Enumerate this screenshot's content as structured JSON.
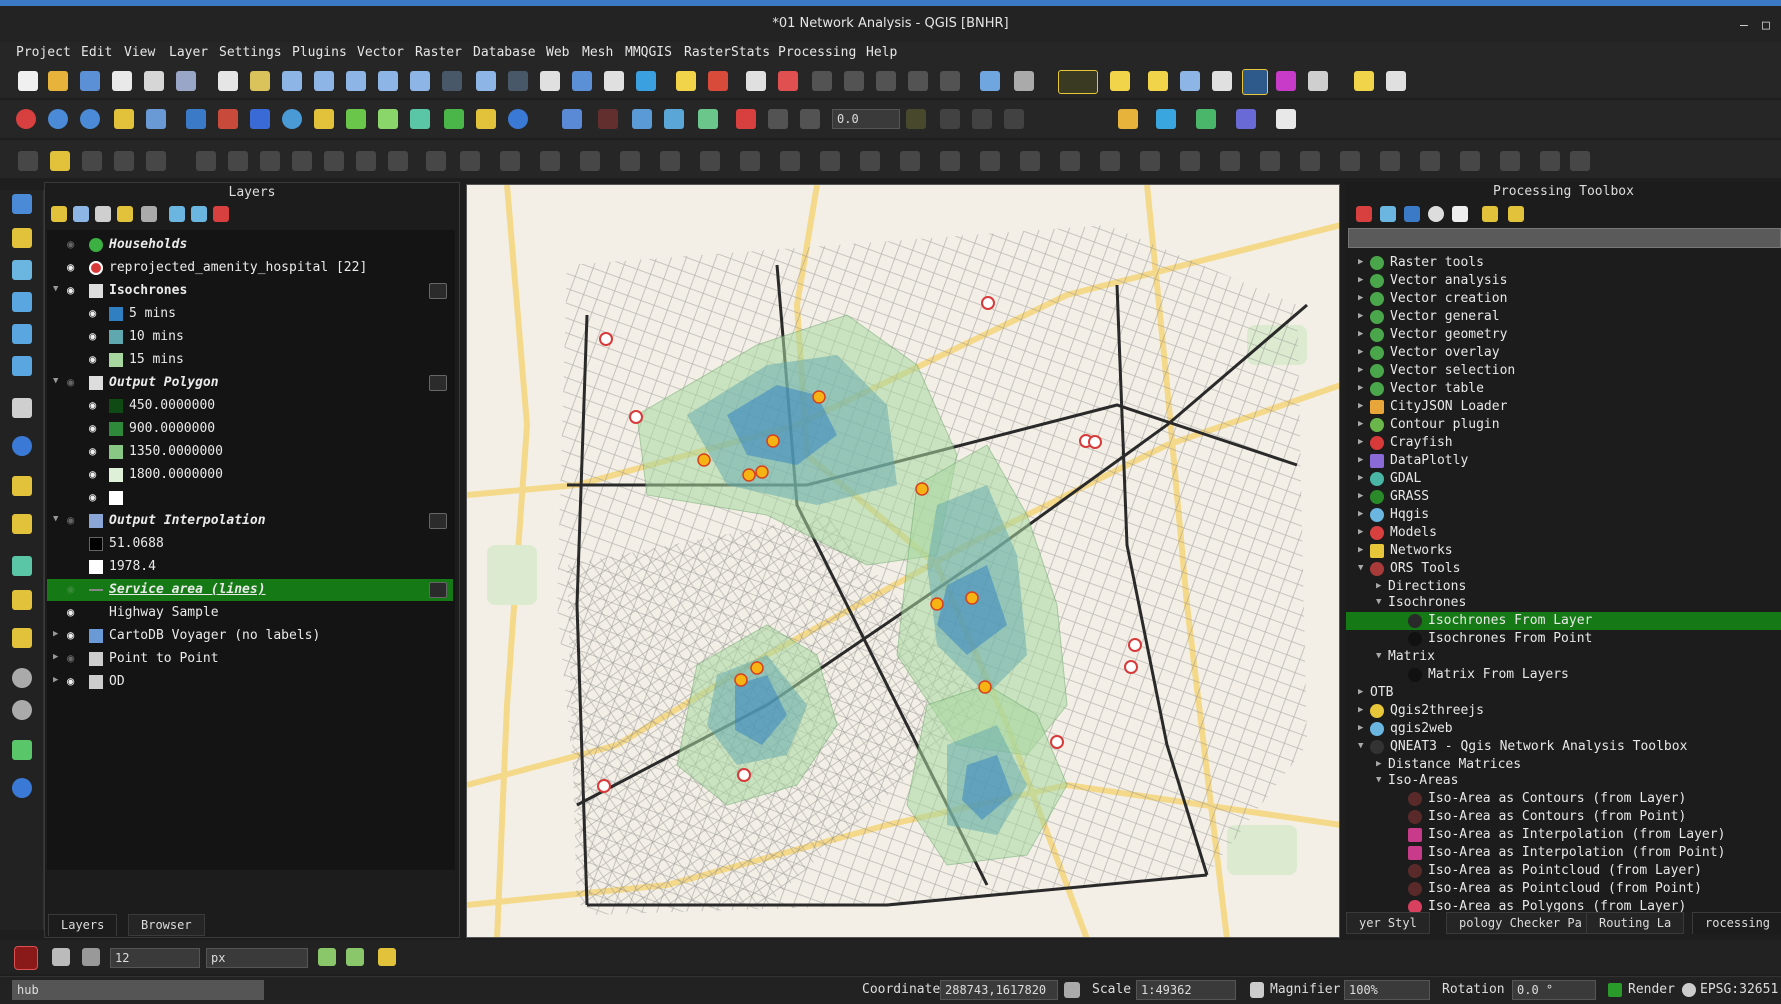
{
  "window": {
    "title": "*01 Network Analysis - QGIS [BNHR]",
    "minimize": "–",
    "maximize": "□"
  },
  "menu": [
    "Project",
    "Edit",
    "View",
    "Layer",
    "Settings",
    "Plugins",
    "Vector",
    "Raster",
    "Database",
    "Web",
    "Mesh",
    "MMQGIS",
    "RasterStats",
    "Processing",
    "Help"
  ],
  "toolbar2": {
    "opacity_value": "0.0"
  },
  "layers_panel": {
    "title": "Layers",
    "items": [
      {
        "label": "Households",
        "style": "bold italic",
        "symbol": "green-dot"
      },
      {
        "label": "reprojected_amenity_hospital [22]",
        "style": "",
        "symbol": "red-cross"
      },
      {
        "label": "Isochrones",
        "style": "bold",
        "symbol": "polygon-group"
      },
      {
        "label": "5 mins",
        "style": "",
        "symbol": "#2f7fc1"
      },
      {
        "label": "10 mins",
        "style": "",
        "symbol": "#5fa8b0"
      },
      {
        "label": "15 mins",
        "style": "",
        "symbol": "#a8d8a0"
      },
      {
        "label": "Output Polygon",
        "style": "bold italic",
        "symbol": "polygon-group"
      },
      {
        "label": "450.0000000",
        "style": "",
        "symbol": "#0f4a14"
      },
      {
        "label": "900.0000000",
        "style": "",
        "symbol": "#2e8a3a"
      },
      {
        "label": "1350.0000000",
        "style": "",
        "symbol": "#88c884"
      },
      {
        "label": "1800.0000000",
        "style": "",
        "symbol": "#dff0d8"
      },
      {
        "label": "",
        "style": "",
        "symbol": "#ffffff"
      },
      {
        "label": "Output Interpolation",
        "style": "bold italic",
        "symbol": "raster"
      },
      {
        "label": "51.0688",
        "style": "",
        "symbol": "#000000"
      },
      {
        "label": "1978.4",
        "style": "",
        "symbol": "#ffffff"
      },
      {
        "label": "Service area (lines)",
        "style": "bold italic underline",
        "symbol": "line"
      },
      {
        "label": "Highway Sample",
        "style": "",
        "symbol": "none"
      },
      {
        "label": "CartoDB Voyager (no labels)",
        "style": "",
        "symbol": "xyz"
      },
      {
        "label": "Point to Point",
        "style": "",
        "symbol": "group"
      },
      {
        "label": "OD",
        "style": "",
        "symbol": "group"
      }
    ],
    "tabs": [
      "Layers",
      "Browser"
    ]
  },
  "toolbox": {
    "title": "Processing Toolbox",
    "search_placeholder": "",
    "items": [
      "Raster tools",
      "Vector analysis",
      "Vector creation",
      "Vector general",
      "Vector geometry",
      "Vector overlay",
      "Vector selection",
      "Vector table",
      "CityJSON Loader",
      "Contour plugin",
      "Crayfish",
      "DataPlotly",
      "GDAL",
      "GRASS",
      "Hqgis",
      "Models",
      "Networks",
      "ORS Tools",
      "Directions",
      "Isochrones",
      "Isochrones From Layer",
      "Isochrones From Point",
      "Matrix",
      "Matrix From Layers",
      "OTB",
      "Qgis2threejs",
      "qgis2web",
      "QNEAT3 - Qgis Network Analysis Toolbox",
      "Distance Matrices",
      "Iso-Areas",
      "Iso-Area as Contours (from Layer)",
      "Iso-Area as Contours (from Point)",
      "Iso-Area as Interpolation (from Layer)",
      "Iso-Area as Interpolation (from Point)",
      "Iso-Area as Pointcloud (from Layer)",
      "Iso-Area as Pointcloud (from Point)",
      "Iso-Area as Polygons (from Layer)"
    ],
    "tabs": [
      "yer Styl",
      "pology Checker Pa",
      "Routing La",
      "rocessing"
    ]
  },
  "snapping": {
    "tolerance": "12",
    "units": "px"
  },
  "status": {
    "search_value": "hub",
    "coordinate_label": "Coordinate",
    "coordinate_value": "288743,1617820",
    "scale_label": "Scale",
    "scale_value": "1:49362",
    "magnifier_label": "Magnifier",
    "magnifier_value": "100%",
    "rotation_label": "Rotation",
    "rotation_value": "0.0 °",
    "render_label": "Render",
    "crs": "EPSG:32651"
  }
}
